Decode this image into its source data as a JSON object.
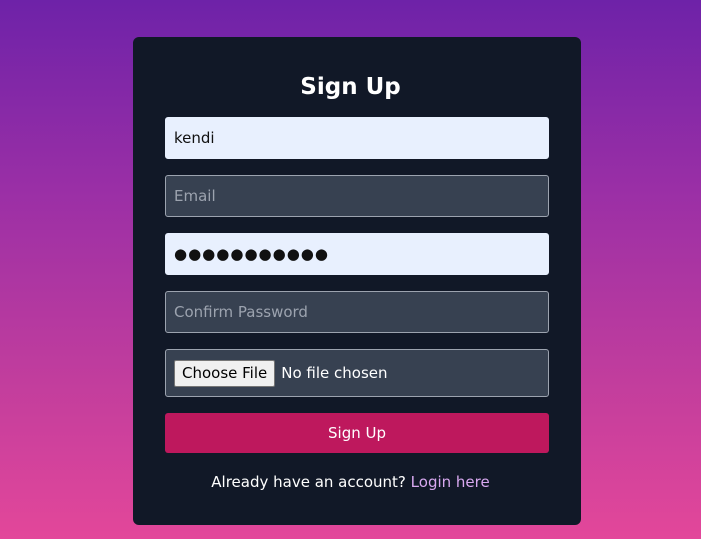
{
  "form": {
    "title": "Sign Up",
    "username": {
      "value": "kendi",
      "placeholder": ""
    },
    "email": {
      "value": "",
      "placeholder": "Email"
    },
    "password": {
      "value": "●●●●●●●●●●●",
      "placeholder": ""
    },
    "confirm_password": {
      "value": "",
      "placeholder": "Confirm Password"
    },
    "file": {
      "button_label": "Choose File",
      "status": "No file chosen"
    },
    "submit_label": "Sign Up",
    "footer_text": "Already have an account?",
    "login_link": "Login here"
  },
  "colors": {
    "card_bg": "#111827",
    "field_filled_bg": "#e8f0fe",
    "field_empty_bg": "#374151",
    "submit_bg": "#be185d",
    "link": "#d8a8f0"
  }
}
